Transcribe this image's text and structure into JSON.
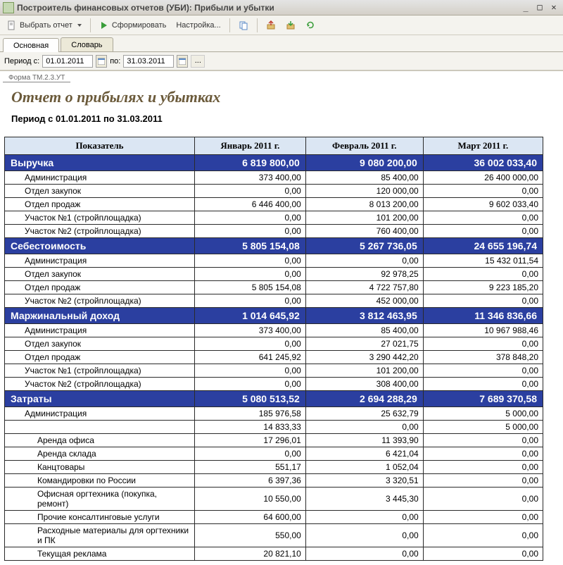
{
  "window": {
    "title": "Построитель финансовых отчетов (УБИ): Прибыли и убытки"
  },
  "toolbar": {
    "select_report": "Выбрать отчет",
    "generate": "Сформировать",
    "settings": "Настройка..."
  },
  "tabs": {
    "main": "Основная",
    "dict": "Словарь"
  },
  "filter": {
    "period_from_label": "Период с:",
    "from": "01.01.2011",
    "to_label": "по:",
    "to": "31.03.2011"
  },
  "report": {
    "form_code": "Форма ТМ.2.3.УТ",
    "title": "Отчет о прибылях и убытках",
    "period_line": "Период с 01.01.2011 по 31.03.2011",
    "headers": {
      "indicator": "Показатель",
      "m1": "Январь 2011 г.",
      "m2": "Февраль 2011 г.",
      "m3": "Март 2011 г."
    }
  },
  "rows": [
    {
      "type": "section",
      "label": "Выручка",
      "v": [
        "6 819 800,00",
        "9 080 200,00",
        "36 002 033,40"
      ]
    },
    {
      "type": "d1",
      "label": "Администрация",
      "v": [
        "373 400,00",
        "85 400,00",
        "26 400 000,00"
      ]
    },
    {
      "type": "d1",
      "label": "Отдел закупок",
      "v": [
        "0,00",
        "120 000,00",
        "0,00"
      ]
    },
    {
      "type": "d1",
      "label": "Отдел продаж",
      "v": [
        "6 446 400,00",
        "8 013 200,00",
        "9 602 033,40"
      ]
    },
    {
      "type": "d1",
      "label": "Участок №1 (стройплощадка)",
      "v": [
        "0,00",
        "101 200,00",
        "0,00"
      ]
    },
    {
      "type": "d1",
      "label": "Участок №2 (стройплощадка)",
      "v": [
        "0,00",
        "760 400,00",
        "0,00"
      ]
    },
    {
      "type": "section",
      "label": "Себестоимость",
      "v": [
        "5 805 154,08",
        "5 267 736,05",
        "24 655 196,74"
      ]
    },
    {
      "type": "d1",
      "label": "Администрация",
      "v": [
        "0,00",
        "0,00",
        "15 432 011,54"
      ]
    },
    {
      "type": "d1",
      "label": "Отдел закупок",
      "v": [
        "0,00",
        "92 978,25",
        "0,00"
      ]
    },
    {
      "type": "d1",
      "label": "Отдел продаж",
      "v": [
        "5 805 154,08",
        "4 722 757,80",
        "9 223 185,20"
      ]
    },
    {
      "type": "d1",
      "label": "Участок №2 (стройплощадка)",
      "v": [
        "0,00",
        "452 000,00",
        "0,00"
      ]
    },
    {
      "type": "section",
      "label": "Маржинальный доход",
      "v": [
        "1 014 645,92",
        "3 812 463,95",
        "11 346 836,66"
      ]
    },
    {
      "type": "d1",
      "label": "Администрация",
      "v": [
        "373 400,00",
        "85 400,00",
        "10 967 988,46"
      ]
    },
    {
      "type": "d1",
      "label": "Отдел закупок",
      "v": [
        "0,00",
        "27 021,75",
        "0,00"
      ]
    },
    {
      "type": "d1",
      "label": "Отдел продаж",
      "v": [
        "641 245,92",
        "3 290 442,20",
        "378 848,20"
      ]
    },
    {
      "type": "d1",
      "label": "Участок №1 (стройплощадка)",
      "v": [
        "0,00",
        "101 200,00",
        "0,00"
      ]
    },
    {
      "type": "d1",
      "label": "Участок №2 (стройплощадка)",
      "v": [
        "0,00",
        "308 400,00",
        "0,00"
      ]
    },
    {
      "type": "section",
      "label": "Затраты",
      "v": [
        "5 080 513,52",
        "2 694 288,29",
        "7 689 370,58"
      ]
    },
    {
      "type": "d1",
      "label": "Администрация",
      "v": [
        "185 976,58",
        "25 632,79",
        "5 000,00"
      ]
    },
    {
      "type": "d2",
      "label": "",
      "v": [
        "14 833,33",
        "0,00",
        "5 000,00"
      ]
    },
    {
      "type": "d2",
      "label": "Аренда офиса",
      "v": [
        "17 296,01",
        "11 393,90",
        "0,00"
      ]
    },
    {
      "type": "d2",
      "label": "Аренда склада",
      "v": [
        "0,00",
        "6 421,04",
        "0,00"
      ]
    },
    {
      "type": "d2",
      "label": "Канцтовары",
      "v": [
        "551,17",
        "1 052,04",
        "0,00"
      ]
    },
    {
      "type": "d2",
      "label": "Командировки по России",
      "v": [
        "6 397,36",
        "3 320,51",
        "0,00"
      ]
    },
    {
      "type": "d2",
      "label": "Офисная оргтехника (покупка, ремонт)",
      "v": [
        "10 550,00",
        "3 445,30",
        "0,00"
      ]
    },
    {
      "type": "d2",
      "label": "Прочие консалтинговые услуги",
      "v": [
        "64 600,00",
        "0,00",
        "0,00"
      ]
    },
    {
      "type": "d2",
      "label": "Расходные материалы для оргтехники и ПК",
      "v": [
        "550,00",
        "0,00",
        "0,00"
      ]
    },
    {
      "type": "d2",
      "label": "Текущая реклама",
      "v": [
        "20 821,10",
        "0,00",
        "0,00"
      ]
    }
  ]
}
